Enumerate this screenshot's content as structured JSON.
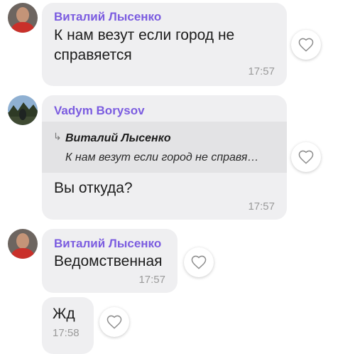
{
  "messages": [
    {
      "sender": "Виталий Лысенко",
      "lines": [
        "К нам везут если город не",
        "справяется"
      ],
      "time": "17:57"
    },
    {
      "sender": "Vadym Borysov",
      "quote": {
        "sender": "Виталий Лысенко",
        "text": "К нам везут если город не справя…"
      },
      "lines": [
        "Вы откуда?"
      ],
      "time": "17:57"
    },
    {
      "sender": "Виталий Лысенко",
      "lines": [
        "Ведомственная"
      ],
      "time": "17:57"
    },
    {
      "lines": [
        "Жд"
      ],
      "time": "17:58"
    }
  ],
  "colors": {
    "sender_name": "#7b5ce0",
    "bubble_bg": "#efeff1",
    "quote_bg": "#e3e3e5",
    "time_text": "#9a9a9a",
    "heart_stroke": "#8a8a8a"
  },
  "icons": {
    "like": "heart-outline-icon",
    "reply": "reply-arrow-icon"
  }
}
